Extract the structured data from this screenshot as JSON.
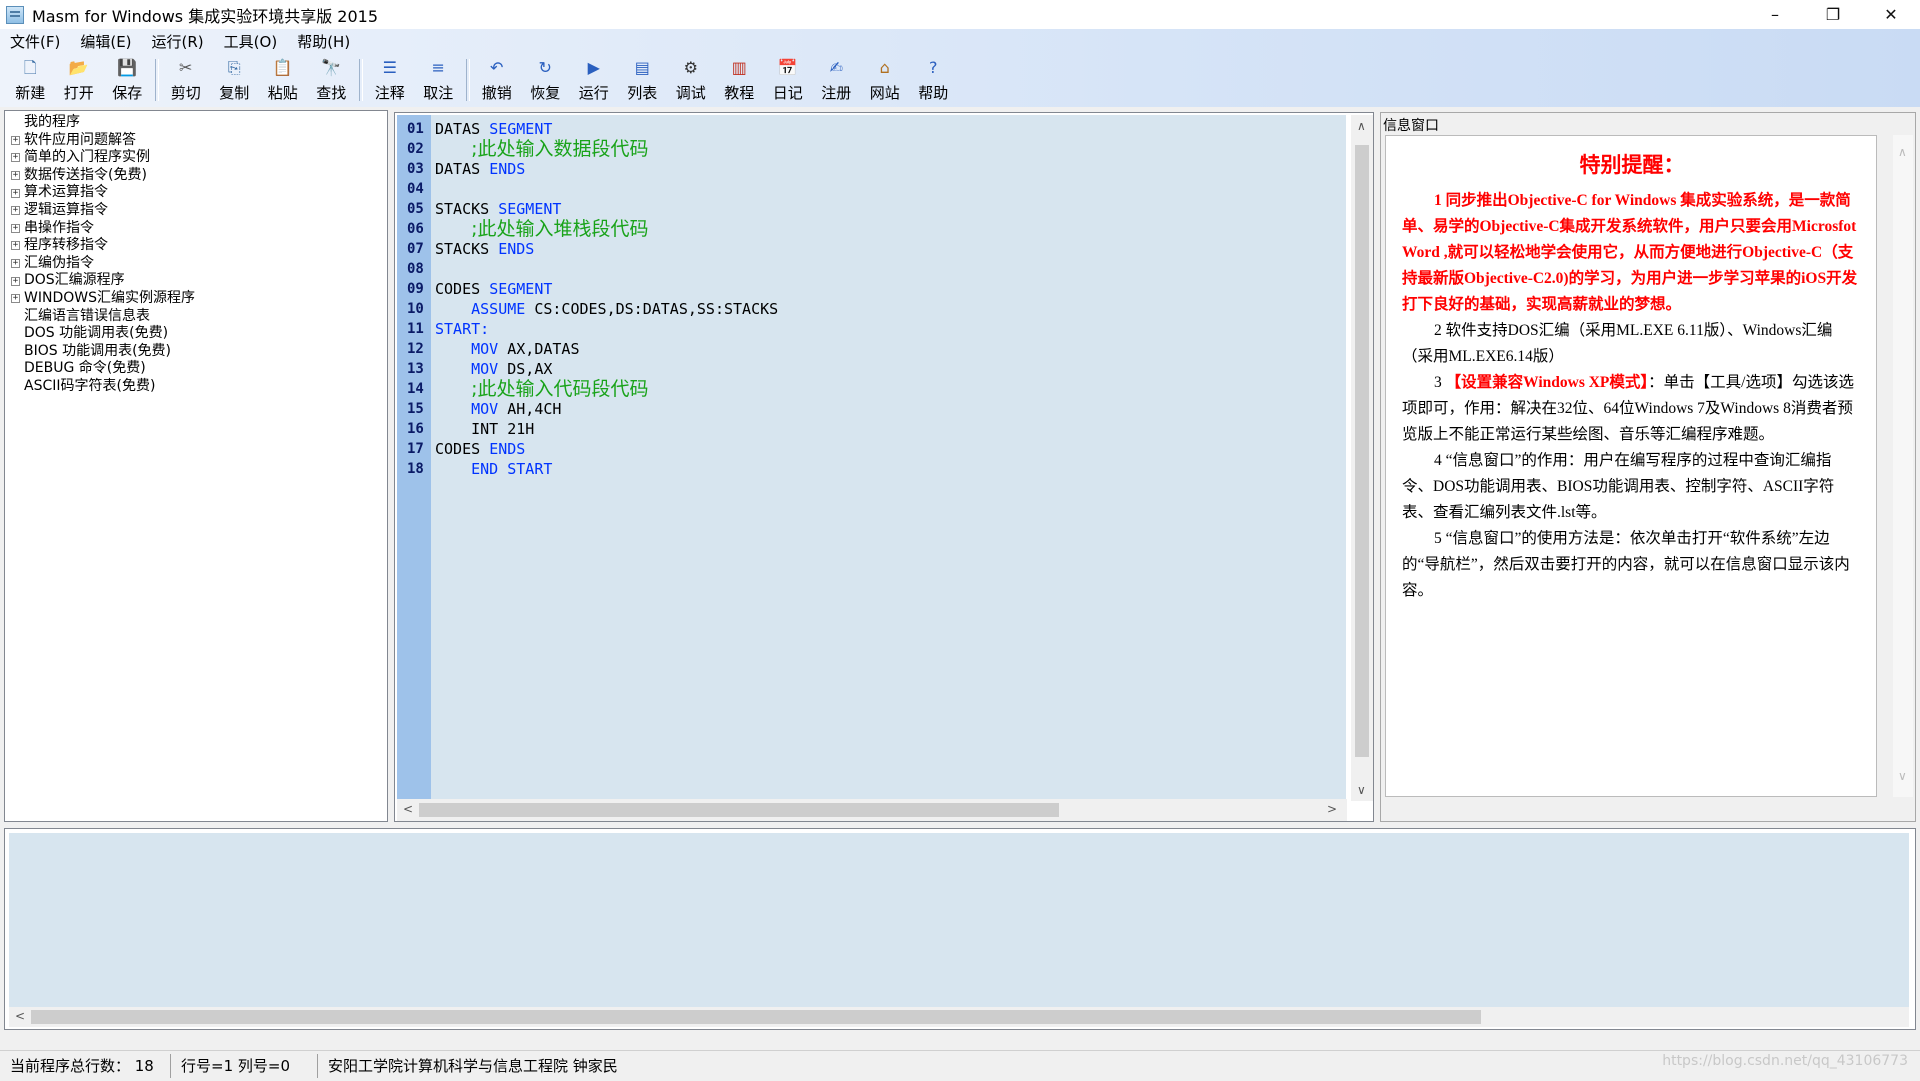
{
  "window": {
    "title": "Masm for Windows 集成实验环境共享版 2015",
    "min": "–",
    "restore": "❐",
    "close": "✕"
  },
  "menu": [
    "文件(F)",
    "编辑(E)",
    "运行(R)",
    "工具(O)",
    "帮助(H)"
  ],
  "toolbar": {
    "groups": [
      [
        {
          "label": "新建",
          "icon": "new-file-icon",
          "glyph": "🗋",
          "color": "#3a6ea5"
        },
        {
          "label": "打开",
          "icon": "open-folder-icon",
          "glyph": "📂",
          "color": "#d9a520"
        },
        {
          "label": "保存",
          "icon": "save-icon",
          "glyph": "💾",
          "color": "#3a3ab0"
        }
      ],
      [
        {
          "label": "剪切",
          "icon": "cut-icon",
          "glyph": "✂",
          "color": "#555"
        },
        {
          "label": "复制",
          "icon": "copy-icon",
          "glyph": "⎘",
          "color": "#3a6ea5"
        },
        {
          "label": "粘贴",
          "icon": "paste-icon",
          "glyph": "📋",
          "color": "#b07020"
        },
        {
          "label": "查找",
          "icon": "find-icon",
          "glyph": "🔭",
          "color": "#444"
        }
      ],
      [
        {
          "label": "注释",
          "icon": "comment-icon",
          "glyph": "☰",
          "color": "#2a5fbf"
        },
        {
          "label": "取注",
          "icon": "uncomment-icon",
          "glyph": "≡",
          "color": "#2a5fbf"
        }
      ],
      [
        {
          "label": "撤销",
          "icon": "undo-icon",
          "glyph": "↶",
          "color": "#2a5fbf"
        },
        {
          "label": "恢复",
          "icon": "redo-icon",
          "glyph": "↻",
          "color": "#2a5fbf"
        },
        {
          "label": "运行",
          "icon": "run-icon",
          "glyph": "▶",
          "color": "#2a5fbf"
        },
        {
          "label": "列表",
          "icon": "list-icon",
          "glyph": "▤",
          "color": "#2a5fbf"
        },
        {
          "label": "调试",
          "icon": "debug-icon",
          "glyph": "⚙",
          "color": "#333"
        },
        {
          "label": "教程",
          "icon": "tutorial-icon",
          "glyph": "▥",
          "color": "#c03020"
        },
        {
          "label": "日记",
          "icon": "diary-icon",
          "glyph": "📅",
          "color": "#c03020"
        },
        {
          "label": "注册",
          "icon": "register-icon",
          "glyph": "✍",
          "color": "#2a5fbf"
        },
        {
          "label": "网站",
          "icon": "home-icon",
          "glyph": "⌂",
          "color": "#b07020"
        },
        {
          "label": "帮助",
          "icon": "help-icon",
          "glyph": "?",
          "color": "#2a5fbf"
        }
      ]
    ]
  },
  "tree": [
    {
      "label": "我的程序",
      "expander": false,
      "mono": false
    },
    {
      "label": "软件应用问题解答",
      "expander": true,
      "mono": false
    },
    {
      "label": "简单的入门程序实例",
      "expander": true,
      "mono": false
    },
    {
      "label": "数据传送指令(免费)",
      "expander": true,
      "mono": false
    },
    {
      "label": "算术运算指令",
      "expander": true,
      "mono": false
    },
    {
      "label": "逻辑运算指令",
      "expander": true,
      "mono": false
    },
    {
      "label": "串操作指令",
      "expander": true,
      "mono": false
    },
    {
      "label": "程序转移指令",
      "expander": true,
      "mono": false
    },
    {
      "label": "汇编伪指令",
      "expander": true,
      "mono": false
    },
    {
      "label": "DOS汇编源程序",
      "expander": true,
      "mono": false
    },
    {
      "label": "WINDOWS汇编实例源程序",
      "expander": true,
      "mono": false
    },
    {
      "label": "汇编语言错误信息表",
      "expander": false,
      "mono": false
    },
    {
      "label": "DOS 功能调用表(免费)",
      "expander": false,
      "mono": false
    },
    {
      "label": "BIOS 功能调用表(免费)",
      "expander": false,
      "mono": false
    },
    {
      "label": "DEBUG 命令(免费)",
      "expander": false,
      "mono": false
    },
    {
      "label": "ASCII码字符表(免费)",
      "expander": false,
      "mono": false
    }
  ],
  "code": [
    {
      "n": "01",
      "indent": "",
      "parts": [
        [
          "txt",
          "DATAS "
        ],
        [
          "kw",
          "SEGMENT"
        ]
      ]
    },
    {
      "n": "02",
      "indent": "    ",
      "parts": [
        [
          "cmt",
          ";此处输入数据段代码"
        ]
      ]
    },
    {
      "n": "03",
      "indent": "",
      "parts": [
        [
          "txt",
          "DATAS "
        ],
        [
          "kw",
          "ENDS"
        ]
      ]
    },
    {
      "n": "04",
      "indent": "",
      "parts": []
    },
    {
      "n": "05",
      "indent": "",
      "parts": [
        [
          "txt",
          "STACKS "
        ],
        [
          "kw",
          "SEGMENT"
        ]
      ]
    },
    {
      "n": "06",
      "indent": "    ",
      "parts": [
        [
          "cmt",
          ";此处输入堆栈段代码"
        ]
      ]
    },
    {
      "n": "07",
      "indent": "",
      "parts": [
        [
          "txt",
          "STACKS "
        ],
        [
          "kw",
          "ENDS"
        ]
      ]
    },
    {
      "n": "08",
      "indent": "",
      "parts": []
    },
    {
      "n": "09",
      "indent": "",
      "parts": [
        [
          "txt",
          "CODES "
        ],
        [
          "kw",
          "SEGMENT"
        ]
      ]
    },
    {
      "n": "10",
      "indent": "    ",
      "parts": [
        [
          "kw",
          "ASSUME"
        ],
        [
          "txt",
          " CS:CODES,DS:DATAS,SS:STACKS"
        ]
      ]
    },
    {
      "n": "11",
      "indent": "",
      "parts": [
        [
          "kw",
          "START:"
        ]
      ]
    },
    {
      "n": "12",
      "indent": "    ",
      "parts": [
        [
          "kw",
          "MOV"
        ],
        [
          "txt",
          " AX,DATAS"
        ]
      ]
    },
    {
      "n": "13",
      "indent": "    ",
      "parts": [
        [
          "kw",
          "MOV"
        ],
        [
          "txt",
          " DS,AX"
        ]
      ]
    },
    {
      "n": "14",
      "indent": "    ",
      "parts": [
        [
          "cmt",
          ";此处输入代码段代码"
        ]
      ]
    },
    {
      "n": "15",
      "indent": "    ",
      "parts": [
        [
          "kw",
          "MOV"
        ],
        [
          "txt",
          " AH,4CH"
        ]
      ]
    },
    {
      "n": "16",
      "indent": "    ",
      "parts": [
        [
          "txt",
          "INT 21H"
        ]
      ]
    },
    {
      "n": "17",
      "indent": "",
      "parts": [
        [
          "txt",
          "CODES "
        ],
        [
          "kw",
          "ENDS"
        ]
      ]
    },
    {
      "n": "18",
      "indent": "    ",
      "parts": [
        [
          "kw",
          "END START"
        ]
      ]
    }
  ],
  "info": {
    "header": "信息窗口",
    "title": "特别提醒：",
    "p1": "1 同步推出Objective-C for Windows 集成实验系统，是一款简单、易学的Objective-C集成开发系统软件，用户只要会用Microsfot Word ,就可以轻松地学会使用它，从而方便地进行Objective-C（支持最新版Objective-C2.0)的学习，为用户进一步学习苹果的iOS开发打下良好的基础，实现高薪就业的梦想。",
    "p2": "2 软件支持DOS汇编（采用ML.EXE 6.11版）、Windows汇编（采用ML.EXE6.14版）",
    "p3_num": "3 ",
    "p3_red": "【设置兼容Windows XP模式】",
    "p3_rest": "：单击【工具/选项】勾选该选项即可，作用：解决在32位、64位Windows 7及Windows 8消费者预览版上不能正常运行某些绘图、音乐等汇编程序难题。",
    "p4": "4 “信息窗口”的作用：用户在编写程序的过程中查询汇编指令、DOS功能调用表、BIOS功能调用表、控制字符、ASCII字符表、查看汇编列表文件.lst等。",
    "p5": "5 “信息窗口”的使用方法是：依次单击打开“软件系统”左边的“导航栏”，然后双击要打开的内容，就可以在信息窗口显示该内容。"
  },
  "status": {
    "total_lines": "当前程序总行数：  18",
    "row_col": "行号=1   列号=0",
    "author": "安阳工学院计算机科学与信息工程院   钟家民"
  },
  "watermark": "https://blog.csdn.net/qq_43106773"
}
